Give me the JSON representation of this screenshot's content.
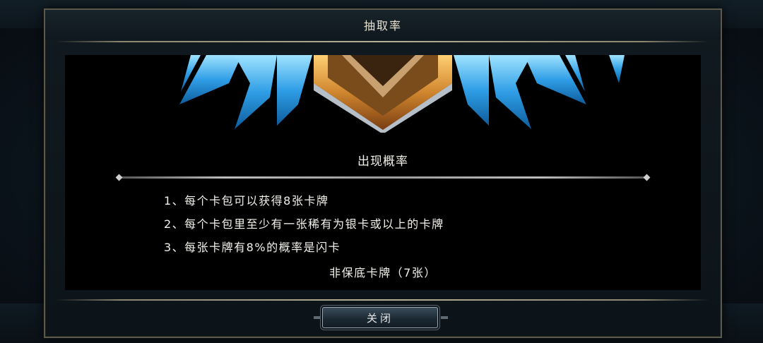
{
  "dialog": {
    "title": "抽取率",
    "section_title": "出现概率",
    "rules": [
      "1、每个卡包可以获得8张卡牌",
      "2、每个卡包里至少有一张稀有为银卡或以上的卡牌",
      "3、每张卡牌有8%的概率是闪卡"
    ],
    "sub_title": "非保底卡牌（7张）",
    "close_label": "关闭"
  },
  "colors": {
    "accent_gold": "#d99a3a",
    "crystal_blue": "#3fb0ee",
    "text": "#f2f0ea"
  }
}
